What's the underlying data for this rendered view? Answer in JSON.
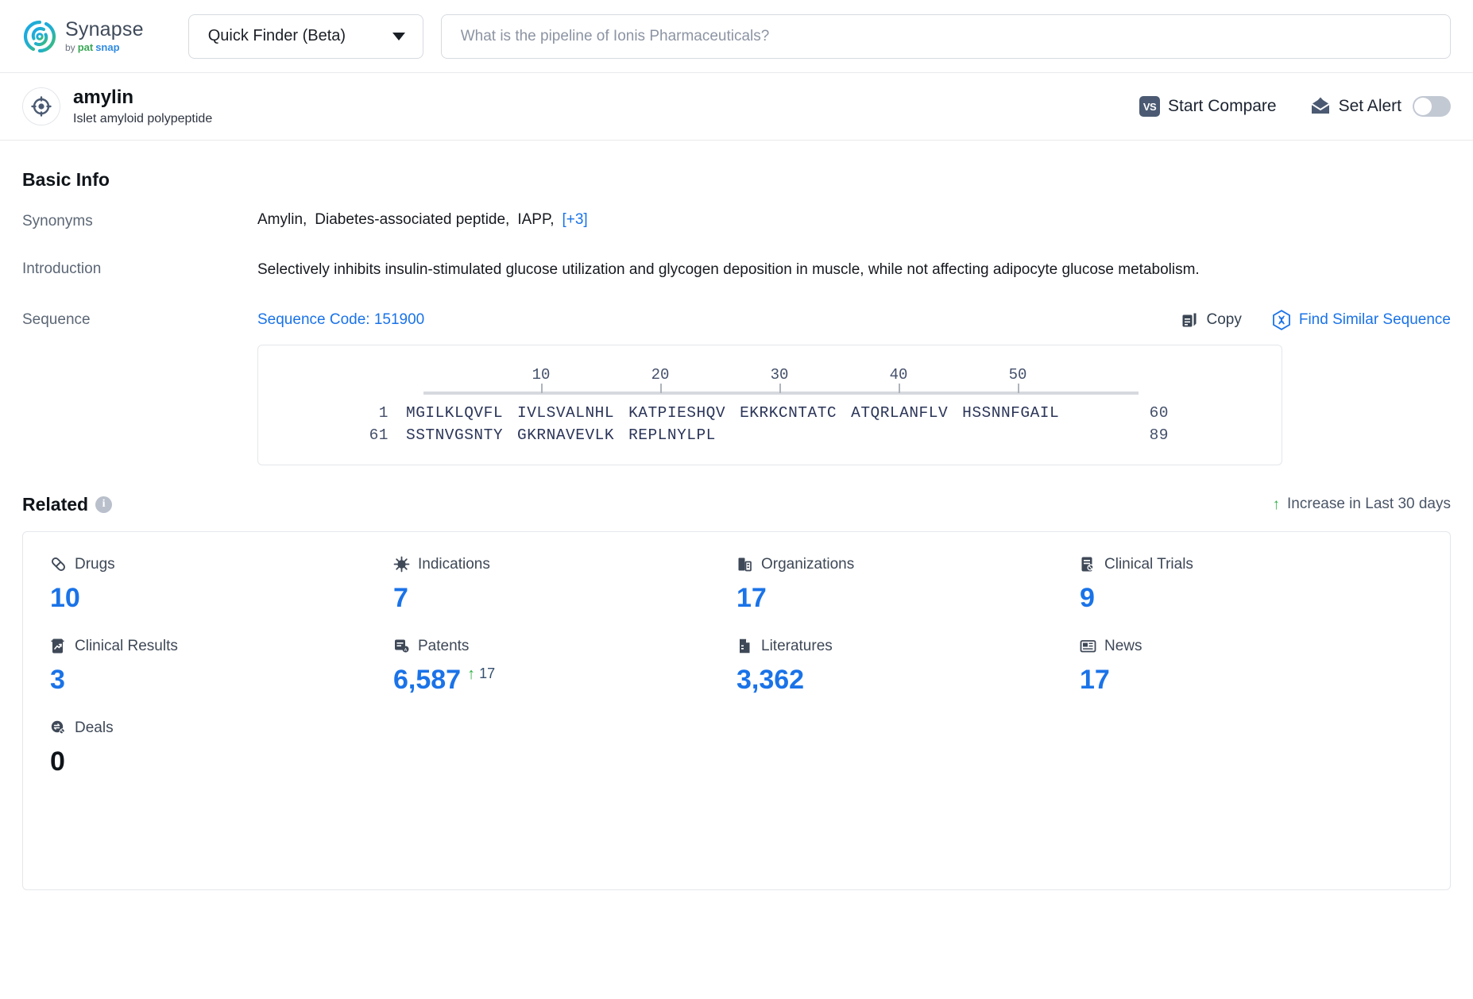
{
  "topbar": {
    "brand_name": "Synapse",
    "brand_by": "by",
    "brand_pat": "pat",
    "brand_snap": "snap",
    "finder_label": "Quick Finder (Beta)",
    "search_placeholder": "What is the pipeline of Ionis Pharmaceuticals?",
    "search_value": ""
  },
  "entity": {
    "name": "amylin",
    "subtitle": "Islet amyloid polypeptide",
    "compare_badge": "VS",
    "compare_label": "Start Compare",
    "alert_label": "Set Alert",
    "alert_on": false
  },
  "basic_info": {
    "title": "Basic Info",
    "synonyms_label": "Synonyms",
    "synonyms": [
      "Amylin,",
      "Diabetes-associated peptide,",
      "IAPP,"
    ],
    "synonyms_more": "[+3]",
    "introduction_label": "Introduction",
    "introduction": "Selectively inhibits insulin-stimulated glucose utilization and glycogen deposition in muscle, while not affecting adipocyte glucose metabolism.",
    "sequence_label": "Sequence",
    "sequence_code": "Sequence Code: 151900",
    "copy_label": "Copy",
    "find_similar_label": "Find Similar Sequence"
  },
  "sequence": {
    "ruler_ticks": [
      10,
      20,
      30,
      40,
      50
    ],
    "lines": [
      {
        "start": "1",
        "chunks": [
          "MGILKLQVFL",
          "IVLSVALNHL",
          "KATPIESHQV",
          "EKRKCNTATC",
          "ATQRLANFLV",
          "HSSNNFGAIL"
        ],
        "end": "60"
      },
      {
        "start": "61",
        "chunks": [
          "SSTNVGSNTY",
          "GKRNAVEVLK",
          "REPLNYLPL"
        ],
        "end": "89"
      }
    ]
  },
  "related": {
    "title": "Related",
    "legend": "Increase in Last 30 days",
    "stats": [
      {
        "icon": "pill-icon",
        "label": "Drugs",
        "value": "10",
        "delta": "",
        "zero": false
      },
      {
        "icon": "virus-icon",
        "label": "Indications",
        "value": "7",
        "delta": "",
        "zero": false
      },
      {
        "icon": "building-icon",
        "label": "Organizations",
        "value": "17",
        "delta": "",
        "zero": false
      },
      {
        "icon": "clinical-trial-icon",
        "label": "Clinical Trials",
        "value": "9",
        "delta": "",
        "zero": false
      },
      {
        "icon": "clinical-result-icon",
        "label": "Clinical Results",
        "value": "3",
        "delta": "",
        "zero": false
      },
      {
        "icon": "patent-icon",
        "label": "Patents",
        "value": "6,587",
        "delta": "17",
        "zero": false
      },
      {
        "icon": "literature-icon",
        "label": "Literatures",
        "value": "3,362",
        "delta": "",
        "zero": false
      },
      {
        "icon": "news-icon",
        "label": "News",
        "value": "17",
        "delta": "",
        "zero": false
      },
      {
        "icon": "deal-icon",
        "label": "Deals",
        "value": "0",
        "delta": "",
        "zero": true
      }
    ]
  },
  "colors": {
    "accent_blue": "#1a73e8",
    "increase_green": "#2fb344",
    "muted": "#5c6775"
  }
}
